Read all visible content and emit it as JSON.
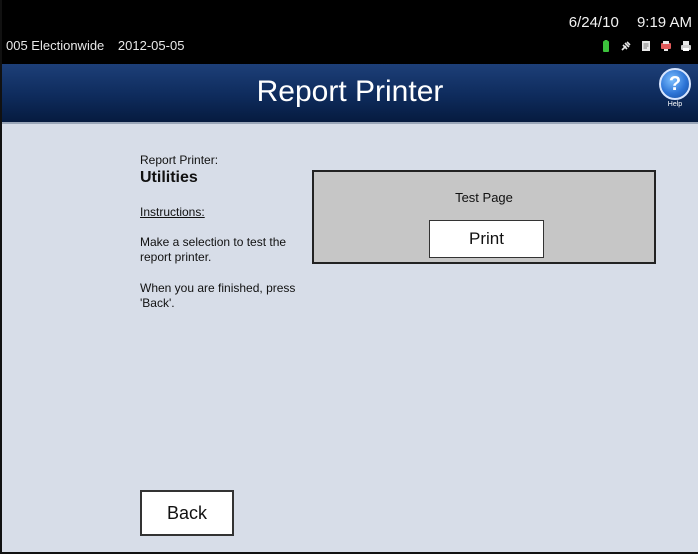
{
  "status": {
    "election_name": "005 Electionwide",
    "election_date": "2012-05-05",
    "date": "6/24/10",
    "time": "9:19 AM",
    "icons": [
      "battery-icon",
      "power-plug-icon",
      "document-icon",
      "network-icon",
      "printer-icon"
    ]
  },
  "header": {
    "title": "Report Printer",
    "help_label": "Help",
    "help_symbol": "?"
  },
  "left_panel": {
    "subtitle": "Report Printer:",
    "heading": "Utilities",
    "instructions_label": "Instructions:",
    "instruction_1": "Make a selection to test the report printer.",
    "instruction_2": "When you are finished, press 'Back'."
  },
  "test_panel": {
    "label": "Test Page",
    "button_label": "Print"
  },
  "footer": {
    "back_label": "Back"
  },
  "colors": {
    "background": "#d7dde8",
    "titlebar": "#0e2b5c",
    "panel": "#c6c6c6",
    "battery": "#3cc23c"
  }
}
